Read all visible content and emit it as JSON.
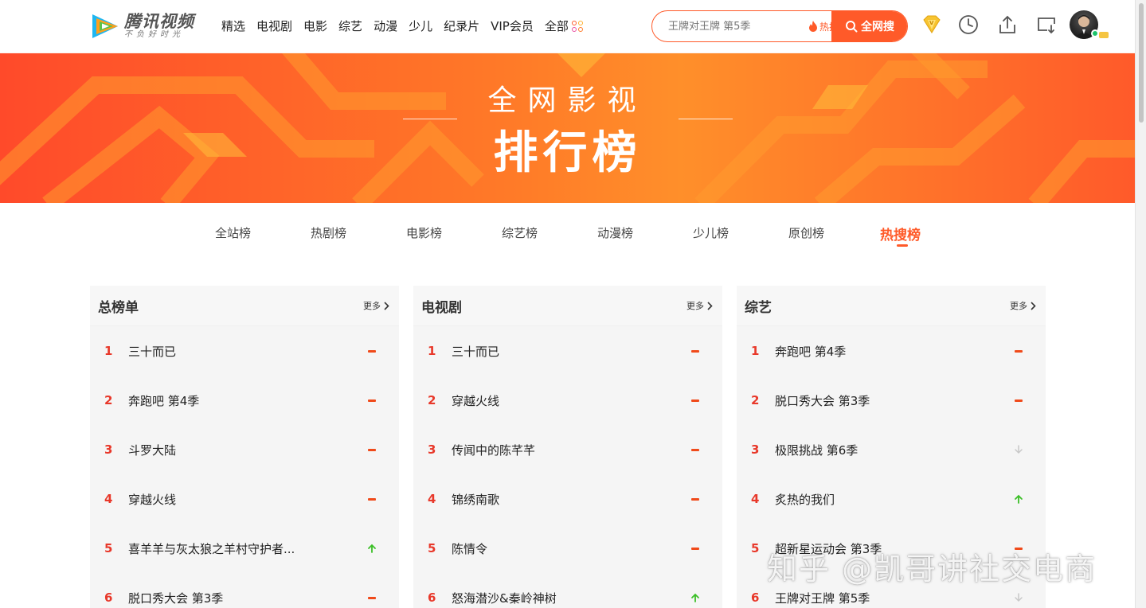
{
  "header": {
    "logo_name": "腾讯视频",
    "logo_slogan": "不负好时光",
    "nav": [
      "精选",
      "电视剧",
      "电影",
      "综艺",
      "动漫",
      "少儿",
      "纪录片",
      "VIP会员"
    ],
    "nav_all": "全部",
    "search_placeholder": "王牌对王牌 第5季",
    "hot_tag": "热搜榜",
    "search_button": "全网搜"
  },
  "banner": {
    "subtitle": "全网影视",
    "title": "排行榜"
  },
  "tabs": [
    "全站榜",
    "热剧榜",
    "电影榜",
    "综艺榜",
    "动漫榜",
    "少儿榜",
    "原创榜",
    "热搜榜"
  ],
  "active_tab": "热搜榜",
  "panels": [
    {
      "title": "总榜单",
      "more": "更多",
      "items": [
        {
          "rank": "1",
          "title": "三十而已",
          "trend": "flat"
        },
        {
          "rank": "2",
          "title": "奔跑吧 第4季",
          "trend": "flat"
        },
        {
          "rank": "3",
          "title": "斗罗大陆",
          "trend": "flat"
        },
        {
          "rank": "4",
          "title": "穿越火线",
          "trend": "flat"
        },
        {
          "rank": "5",
          "title": "喜羊羊与灰太狼之羊村守护者...",
          "trend": "up"
        },
        {
          "rank": "6",
          "title": "脱口秀大会 第3季",
          "trend": "flat"
        }
      ]
    },
    {
      "title": "电视剧",
      "more": "更多",
      "items": [
        {
          "rank": "1",
          "title": "三十而已",
          "trend": "flat"
        },
        {
          "rank": "2",
          "title": "穿越火线",
          "trend": "flat"
        },
        {
          "rank": "3",
          "title": "传闻中的陈芊芊",
          "trend": "flat"
        },
        {
          "rank": "4",
          "title": "锦绣南歌",
          "trend": "flat"
        },
        {
          "rank": "5",
          "title": "陈情令",
          "trend": "flat"
        },
        {
          "rank": "6",
          "title": "怒海潜沙&秦岭神树",
          "trend": "up"
        }
      ]
    },
    {
      "title": "综艺",
      "more": "更多",
      "items": [
        {
          "rank": "1",
          "title": "奔跑吧 第4季",
          "trend": "flat"
        },
        {
          "rank": "2",
          "title": "脱口秀大会 第3季",
          "trend": "flat"
        },
        {
          "rank": "3",
          "title": "极限挑战 第6季",
          "trend": "down"
        },
        {
          "rank": "4",
          "title": "炙热的我们",
          "trend": "up"
        },
        {
          "rank": "5",
          "title": "超新星运动会 第3季",
          "trend": "flat"
        },
        {
          "rank": "6",
          "title": "王牌对王牌 第5季",
          "trend": "down"
        }
      ]
    }
  ],
  "watermark": "知乎 @凯哥讲社交电商",
  "colors": {
    "accent": "#ff5a29",
    "rank": "#e8382a",
    "trend_up": "#3bbf27",
    "trend_down": "#c8c8c8"
  }
}
